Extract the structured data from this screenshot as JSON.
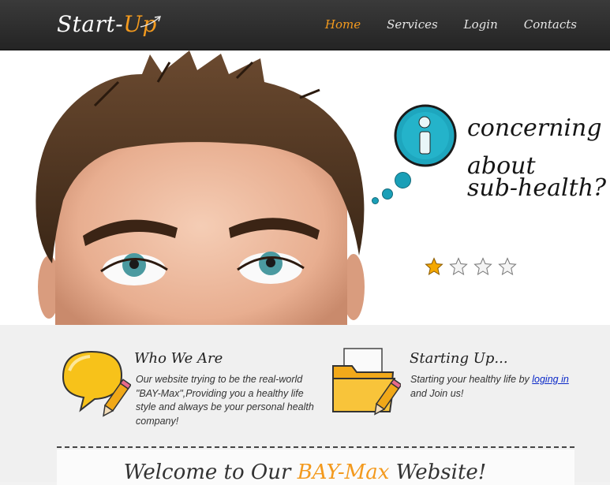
{
  "header": {
    "logo": {
      "text": "Start-",
      "accent": "Up"
    },
    "nav": [
      "Home",
      "Services",
      "Login",
      "Contacts"
    ],
    "active_nav": "Home"
  },
  "hero": {
    "line1": "concerning",
    "line2": "about",
    "line3": "sub-health?",
    "rating": {
      "value": 1,
      "max": 4
    }
  },
  "who": {
    "title": "Who We Are",
    "text": "Our website trying to be the real-world \"BAY-Max\",Providing you a healthy life style and always be your personal health company!"
  },
  "start": {
    "title": "Starting Up...",
    "text_before": "Starting your healthy life by ",
    "link": "loging in",
    "text_after": "and Join us!"
  },
  "welcome": {
    "before": "Welcome to Our ",
    "accent": "BAY-Max",
    "after": " Website!"
  },
  "colors": {
    "accent": "#f39a1e",
    "header": "#2b2b2b",
    "teal": "#1a9fb7",
    "link": "#0a28c8"
  }
}
